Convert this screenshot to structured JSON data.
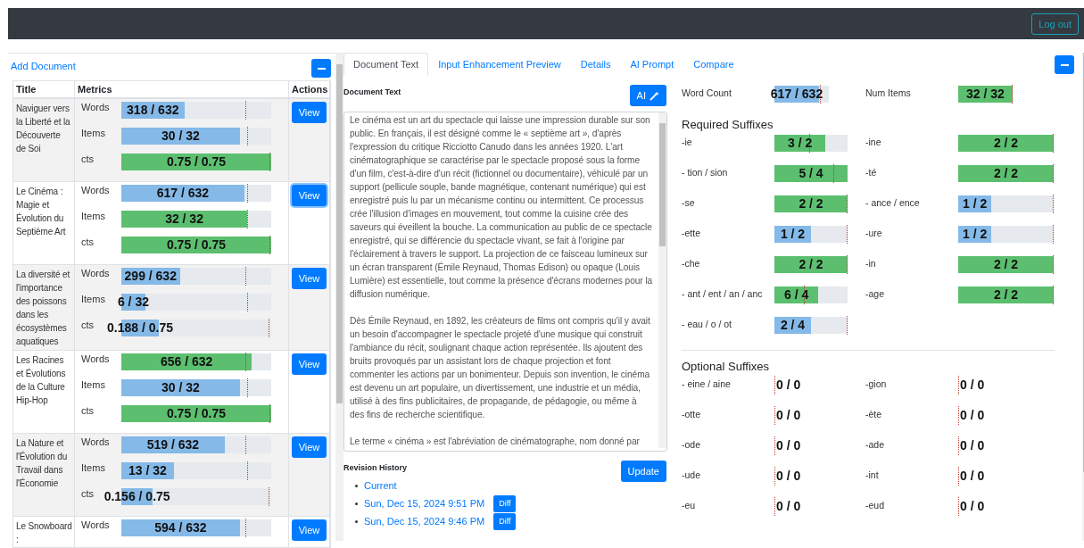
{
  "header": {
    "logout_button": "Log out"
  },
  "documents": {
    "add_link": "Add Document",
    "columns": [
      "Title",
      "Metrics",
      "Actions"
    ],
    "rows": [
      {
        "title": "Naviguer vers la Liberté et la Découverte de Soi",
        "focused": false,
        "action": "View",
        "metrics": [
          {
            "label": "Words",
            "bar": {
              "text": "318 / 632",
              "met": false,
              "level": 0.42,
              "target": {
                "level": 0.83
              }
            }
          },
          {
            "label": "Items",
            "bar": {
              "text": "30 / 32",
              "met": false,
              "level": 0.79,
              "target": {
                "level": 0.84
              }
            }
          },
          {
            "label": "cts",
            "bar": {
              "text": "0.75 / 0.75",
              "met": true,
              "level": 1,
              "target": {
                "level": 0.99
              }
            }
          }
        ]
      },
      {
        "title": "Le Cinéma : Magie et Évolution du Septième Art",
        "focused": true,
        "action": "View",
        "metrics": [
          {
            "label": "Words",
            "bar": {
              "text": "617 / 632",
              "met": false,
              "level": 0.82,
              "target": {
                "level": 0.84
              }
            }
          },
          {
            "label": "Items",
            "bar": {
              "text": "32 / 32",
              "met": true,
              "level": 0.84,
              "target": {
                "level": 0.84
              }
            }
          },
          {
            "label": "cts",
            "bar": {
              "text": "0.75 / 0.75",
              "met": true,
              "level": 1,
              "target": {
                "level": 0.99
              }
            }
          }
        ]
      },
      {
        "title": "La diversité et l'importance des poissons dans les écosystèmes aquatiques",
        "focused": false,
        "action": "View",
        "metrics": [
          {
            "label": "Words",
            "bar": {
              "text": "299 / 632",
              "met": false,
              "level": 0.39,
              "target": {
                "level": 0.83
              }
            }
          },
          {
            "label": "Items",
            "bar": {
              "text": "6 / 32",
              "met": false,
              "level": 0.16,
              "target": {
                "level": 0.84
              }
            }
          },
          {
            "label": "cts",
            "bar": {
              "text": "0.188 / 0.75",
              "met": false,
              "level": 0.25,
              "target": {
                "level": 0.98
              }
            }
          }
        ]
      },
      {
        "title": "Les Racines et Évolutions de la Culture Hip-Hop",
        "focused": false,
        "action": "View",
        "metrics": [
          {
            "label": "Words",
            "bar": {
              "text": "656 / 632",
              "met": true,
              "level": 0.87,
              "target": {
                "level": 0.83
              }
            }
          },
          {
            "label": "Items",
            "bar": {
              "text": "30 / 32",
              "met": false,
              "level": 0.79,
              "target": {
                "level": 0.84
              }
            }
          },
          {
            "label": "cts",
            "bar": {
              "text": "0.75 / 0.75",
              "met": true,
              "level": 1,
              "target": {
                "level": 0.99
              }
            }
          }
        ]
      },
      {
        "title": "La Nature et l'Évolution du Travail dans l'Économie",
        "focused": false,
        "action": "View",
        "metrics": [
          {
            "label": "Words",
            "bar": {
              "text": "519 / 632",
              "met": false,
              "level": 0.69,
              "target": {
                "level": 0.83
              }
            }
          },
          {
            "label": "Items",
            "bar": {
              "text": "13 / 32",
              "met": false,
              "level": 0.35,
              "target": {
                "level": 0.84
              }
            }
          },
          {
            "label": "cts",
            "bar": {
              "text": "0.156 / 0.75",
              "met": false,
              "level": 0.21,
              "target": {
                "level": 0.98
              }
            }
          }
        ]
      },
      {
        "title": "Le Snowboard :",
        "focused": false,
        "action": "View",
        "metrics": [
          {
            "label": "Words",
            "bar": {
              "text": "594 / 632",
              "met": false,
              "level": 0.79,
              "target": {
                "level": 0.83
              }
            }
          }
        ]
      }
    ]
  },
  "tabs": [
    {
      "label": "Document Text",
      "selected": true
    },
    {
      "label": "Input Enhancement Preview",
      "selected": false
    },
    {
      "label": "Details",
      "selected": false
    },
    {
      "label": "AI Prompt",
      "selected": false
    },
    {
      "label": "Compare",
      "selected": false
    }
  ],
  "editor": {
    "heading": "Document Text",
    "ai_button": "AI",
    "paragraphs": [
      "Le cinéma est un art du spectacle qui laisse une impression durable sur son public. En français, il est désigné comme le « septième art », d'après l'expression du critique Ricciotto Canudo dans les années 1920. L'art cinématographique se caractérise par le spectacle proposé sous la forme d'un film, c'est-à-dire d'un récit (fictionnel ou documentaire), véhiculé par un support (pellicule souple, bande magnétique, contenant numérique) qui est enregistré puis lu par un mécanisme continu ou intermittent. Ce processus crée l'illusion d'images en mouvement, tout comme la cuisine crée des saveurs qui éveillent la bouche. La communication au public de ce spectacle enregistré, qui se différencie du spectacle vivant, se fait à l'origine par l'éclairement à travers le support. La projection de ce faisceau lumineux sur un écran transparent (Émile Reynaud, Thomas Edison) ou opaque (Louis Lumière) est essentielle, tout comme la présence d'écrans modernes pour la diffusion numérique.",
      "Dès Émile Reynaud, en 1892, les créateurs de films ont compris qu'il y avait un besoin d'accompagner le spectacle projeté d'une musique qui construit l'ambiance du récit, soulignant chaque action représentée. Ils ajoutent des bruits provoqués par un assistant lors de chaque projection et font commenter les actions par un bonimenteur. Depuis son invention, le cinéma est devenu un art populaire, un divertissement, une industrie et un média, utilisé à des fins publicitaires, de propagande, de pédagogie, ou même à des fins de recherche scientifique.",
      "Le terme « cinéma » est l'abréviation de cinématographe, nom donné par"
    ]
  },
  "revisions": {
    "heading": "Revision History",
    "update_button": "Update",
    "items": [
      {
        "label": "Current"
      },
      {
        "label": "Sun, Dec 15, 2024 9:51 PM",
        "diff": "Diff"
      },
      {
        "label": "Sun, Dec 15, 2024 9:46 PM",
        "diff": "Diff"
      }
    ]
  },
  "summary": [
    {
      "label": "Word Count",
      "bar": {
        "text": "617 / 632",
        "met": false,
        "level": 0.82,
        "target": {
          "level": 0.83
        }
      }
    },
    {
      "label": "Num Items",
      "bar": {
        "text": "32 / 32",
        "met": true,
        "level": 1,
        "target": {
          "level": 1
        }
      }
    }
  ],
  "required": {
    "heading": "Required Suffixes",
    "items": [
      {
        "label": "-ie",
        "bar": {
          "text": "3 / 2",
          "met": true,
          "level": 0.7,
          "target": {
            "level": 0.48
          }
        }
      },
      {
        "label": "-ine",
        "bar": {
          "text": "2 / 2",
          "met": true,
          "level": 1,
          "target": {
            "level": 1
          }
        }
      },
      {
        "label": "- tion / sion",
        "bar": {
          "text": "5 / 4",
          "met": true,
          "level": 1,
          "target": {
            "level": 0.8
          }
        }
      },
      {
        "label": "-té",
        "bar": {
          "text": "2 / 2",
          "met": true,
          "level": 1,
          "target": {
            "level": 1
          }
        }
      },
      {
        "label": "-se",
        "bar": {
          "text": "2 / 2",
          "met": true,
          "level": 1,
          "target": {
            "level": 1
          }
        }
      },
      {
        "label": "- ance / ence",
        "bar": {
          "text": "1 / 2",
          "met": false,
          "level": 0.35,
          "target": {
            "level": 1
          }
        }
      },
      {
        "label": "-ette",
        "bar": {
          "text": "1 / 2",
          "met": false,
          "level": 0.5,
          "target": {
            "level": 1
          }
        }
      },
      {
        "label": "-ure",
        "bar": {
          "text": "1 / 2",
          "met": false,
          "level": 0.35,
          "target": {
            "level": 1
          }
        }
      },
      {
        "label": "-che",
        "bar": {
          "text": "2 / 2",
          "met": true,
          "level": 1,
          "target": {
            "level": 1
          }
        }
      },
      {
        "label": "-in",
        "bar": {
          "text": "2 / 2",
          "met": true,
          "level": 1,
          "target": {
            "level": 1
          }
        }
      },
      {
        "label": "- ant / ent / an / anc",
        "bar": {
          "text": "6 / 4",
          "met": true,
          "level": 0.6,
          "target": {
            "level": 0.4
          }
        }
      },
      {
        "label": "-age",
        "bar": {
          "text": "2 / 2",
          "met": true,
          "level": 1,
          "target": {
            "level": 1
          }
        }
      },
      {
        "label": "- eau / o / ot",
        "bar": {
          "text": "2 / 4",
          "met": false,
          "level": 0.5,
          "target": {
            "level": 1
          }
        }
      }
    ]
  },
  "optional": {
    "heading": "Optional Suffixes",
    "items": [
      {
        "label": "- eine / aine",
        "bar": {
          "text": "0 / 0"
        }
      },
      {
        "label": "-gion",
        "bar": {
          "text": "0 / 0"
        }
      },
      {
        "label": "-otte",
        "bar": {
          "text": "0 / 0"
        }
      },
      {
        "label": "-ète",
        "bar": {
          "text": "0 / 0"
        }
      },
      {
        "label": "-ode",
        "bar": {
          "text": "0 / 0"
        }
      },
      {
        "label": "-ade",
        "bar": {
          "text": "0 / 0"
        }
      },
      {
        "label": "-ude",
        "bar": {
          "text": "0 / 0"
        }
      },
      {
        "label": "-int",
        "bar": {
          "text": "0 / 0"
        }
      },
      {
        "label": "-eu",
        "bar": {
          "text": "0 / 0"
        }
      },
      {
        "label": "-eud",
        "bar": {
          "text": "0 / 0"
        }
      }
    ]
  }
}
